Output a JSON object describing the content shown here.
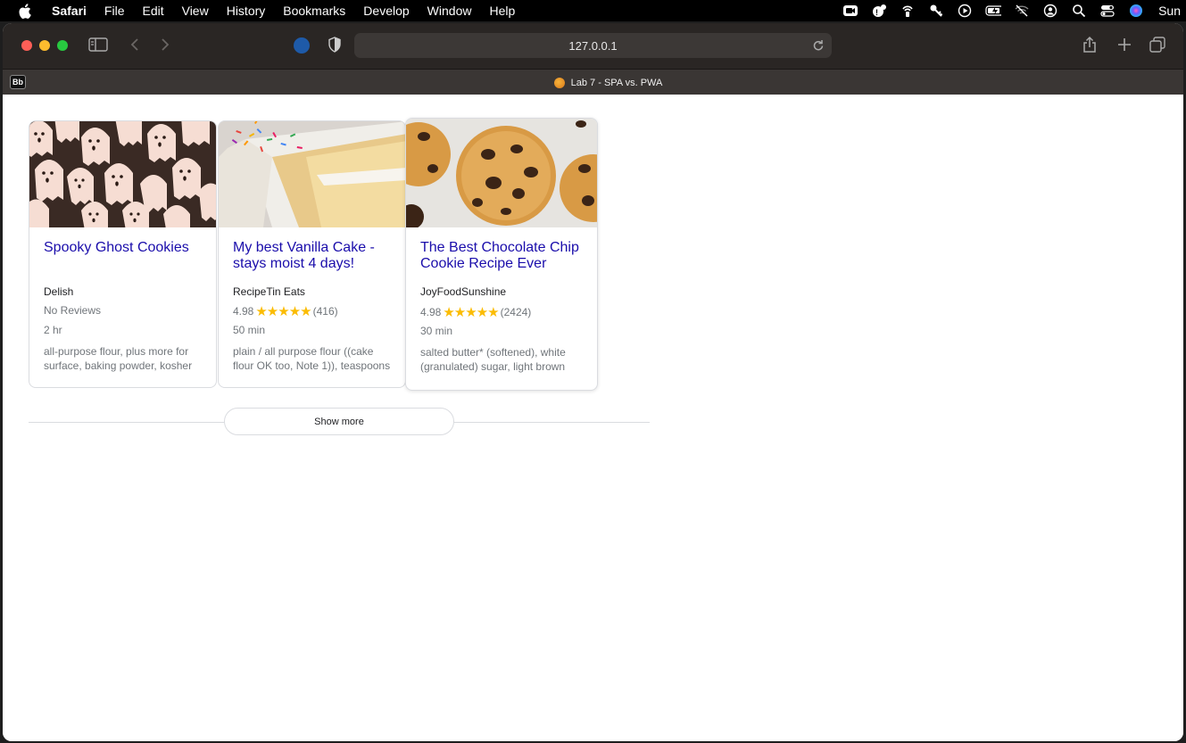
{
  "menubar": {
    "app_name": "Safari",
    "items": [
      "File",
      "Edit",
      "View",
      "History",
      "Bookmarks",
      "Develop",
      "Window",
      "Help"
    ],
    "clock": "Sun"
  },
  "browser": {
    "address": "127.0.0.1",
    "pinned_tab_label": "Bb",
    "active_tab_title": "Lab 7 - SPA vs. PWA"
  },
  "recipes": [
    {
      "title": "Spooky Ghost Cookies",
      "source": "Delish",
      "rating_text": "No Reviews",
      "rating": null,
      "count": "",
      "time": "2 hr",
      "ingredients": "all-purpose flour, plus more for surface, baking powder, kosher"
    },
    {
      "title": "My best Vanilla Cake - stays moist 4 days!",
      "source": "RecipeTin Eats",
      "rating": "4.98",
      "stars": "★★★★★",
      "count": "(416)",
      "time": "50 min",
      "ingredients": "plain / all purpose flour ((cake flour OK too, Note 1)), teaspoons"
    },
    {
      "title": "The Best Chocolate Chip Cookie Recipe Ever",
      "source": "JoyFoodSunshine",
      "rating": "4.98",
      "stars": "★★★★★",
      "count": "(2424)",
      "time": "30 min",
      "ingredients": "salted butter* (softened), white (granulated) sugar, light brown"
    }
  ],
  "show_more_label": "Show more"
}
